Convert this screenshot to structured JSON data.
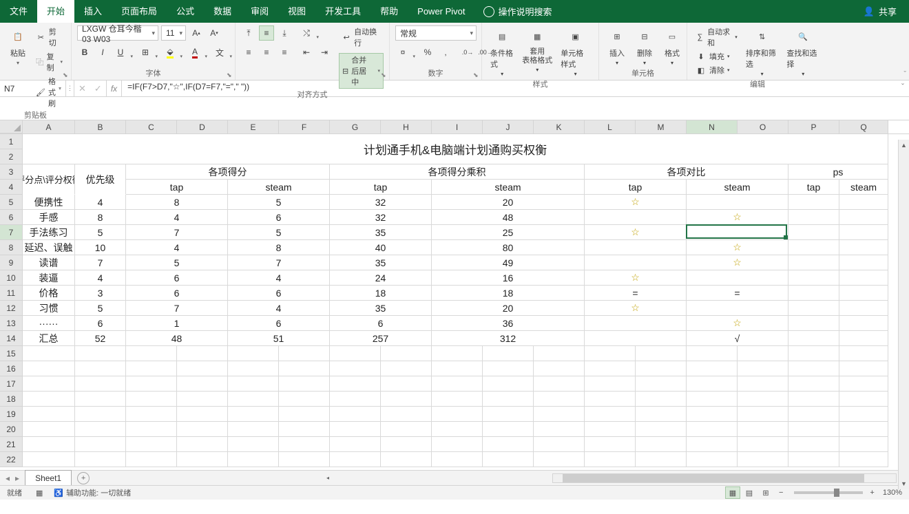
{
  "tabs": {
    "file": "文件",
    "home": "开始",
    "insert": "插入",
    "layout": "页面布局",
    "formula": "公式",
    "data": "数据",
    "review": "审阅",
    "view": "视图",
    "dev": "开发工具",
    "help": "帮助",
    "pivot": "Power Pivot"
  },
  "tellme": "操作说明搜索",
  "share": "共享",
  "clipboard": {
    "label": "剪贴板",
    "paste": "粘贴",
    "cut": "剪切",
    "copy": "复制",
    "painter": "格式刷"
  },
  "font": {
    "label": "字体",
    "name": "LXGW 仓耳今楷03 W03",
    "size": "11"
  },
  "align": {
    "label": "对齐方式",
    "wrap": "自动换行",
    "merge": "合并后居中"
  },
  "number": {
    "label": "数字",
    "format": "常规"
  },
  "styles": {
    "label": "样式",
    "cond": "条件格式",
    "table": "套用\n表格格式",
    "cell": "单元格样式"
  },
  "cells": {
    "label": "单元格",
    "insert": "插入",
    "delete": "删除",
    "format": "格式"
  },
  "editing": {
    "label": "编辑",
    "sum": "自动求和",
    "fill": "填充",
    "clear": "清除",
    "sort": "排序和筛选",
    "find": "查找和选择"
  },
  "namebox": "N7",
  "formula": "=IF(F7>D7,\"☆\",IF(D7=F7,\"=\",\" \"))",
  "colWidths": {
    "A": 76,
    "B": 74,
    "C": 74,
    "D": 74,
    "E": 74,
    "F": 74,
    "G": 74,
    "H": 74,
    "I": 74,
    "J": 74,
    "K": 74,
    "L": 74,
    "M": 74,
    "N": 74,
    "O": 74,
    "P": 74,
    "Q": 71
  },
  "columns": [
    "A",
    "B",
    "C",
    "D",
    "E",
    "F",
    "G",
    "H",
    "I",
    "J",
    "K",
    "L",
    "M",
    "N",
    "O",
    "P",
    "Q"
  ],
  "grid": {
    "title": "计划通手机&电脑端计划通购买权衡",
    "header1": {
      "a": "评分点\\评分权衡",
      "b": "优先级",
      "c1": "各项得分",
      "c2": "各项得分乘积",
      "c3": "各项对比",
      "c4": "ps"
    },
    "header2": {
      "tap": "tap",
      "steam": "steam"
    },
    "rows": [
      {
        "name": "便携性",
        "pri": "4",
        "tap": "8",
        "steam": "5",
        "tapM": "32",
        "steamM": "20",
        "cmpT": "☆",
        "cmpS": ""
      },
      {
        "name": "手感",
        "pri": "8",
        "tap": "4",
        "steam": "6",
        "tapM": "32",
        "steamM": "48",
        "cmpT": "",
        "cmpS": "☆"
      },
      {
        "name": "手法练习",
        "pri": "5",
        "tap": "7",
        "steam": "5",
        "tapM": "35",
        "steamM": "25",
        "cmpT": "☆",
        "cmpS": ""
      },
      {
        "name": "延迟、误触",
        "pri": "10",
        "tap": "4",
        "steam": "8",
        "tapM": "40",
        "steamM": "80",
        "cmpT": "",
        "cmpS": "☆"
      },
      {
        "name": "读谱",
        "pri": "7",
        "tap": "5",
        "steam": "7",
        "tapM": "35",
        "steamM": "49",
        "cmpT": "",
        "cmpS": "☆"
      },
      {
        "name": "装逼",
        "pri": "4",
        "tap": "6",
        "steam": "4",
        "tapM": "24",
        "steamM": "16",
        "cmpT": "☆",
        "cmpS": ""
      },
      {
        "name": "价格",
        "pri": "3",
        "tap": "6",
        "steam": "6",
        "tapM": "18",
        "steamM": "18",
        "cmpT": "=",
        "cmpS": "="
      },
      {
        "name": "习惯",
        "pri": "5",
        "tap": "7",
        "steam": "4",
        "tapM": "35",
        "steamM": "20",
        "cmpT": "☆",
        "cmpS": ""
      },
      {
        "name": "······",
        "pri": "6",
        "tap": "1",
        "steam": "6",
        "tapM": "6",
        "steamM": "36",
        "cmpT": "",
        "cmpS": "☆"
      },
      {
        "name": "汇总",
        "pri": "52",
        "tap": "48",
        "steam": "51",
        "tapM": "257",
        "steamM": "312",
        "cmpT": "",
        "cmpS": "√"
      }
    ]
  },
  "sheet": "Sheet1",
  "status": {
    "ready": "就绪",
    "acc": "辅助功能: 一切就绪",
    "zoom": "130%"
  }
}
